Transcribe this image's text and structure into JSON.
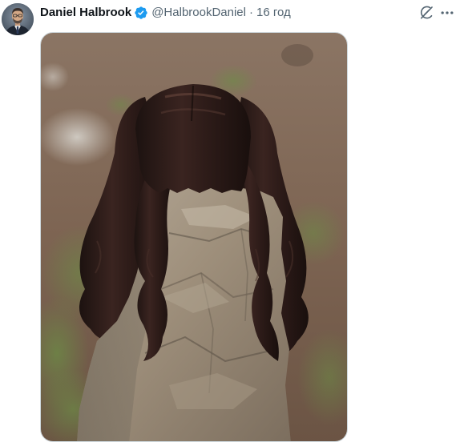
{
  "tweet": {
    "author": {
      "display_name": "Daniel Halbrook",
      "handle": "@HalbrookDaniel",
      "verified": true,
      "verified_color": "#1d9bf0"
    },
    "separator": "·",
    "time": "16 год",
    "media": {
      "icon": "photo"
    }
  },
  "icons": {
    "grok": "grok-icon",
    "more": "more-horizontal-icon",
    "verified": "verified-badge-icon"
  },
  "colors": {
    "text_primary": "#0f1419",
    "text_secondary": "#536471",
    "accent": "#1d9bf0",
    "border": "#cfd9de"
  }
}
